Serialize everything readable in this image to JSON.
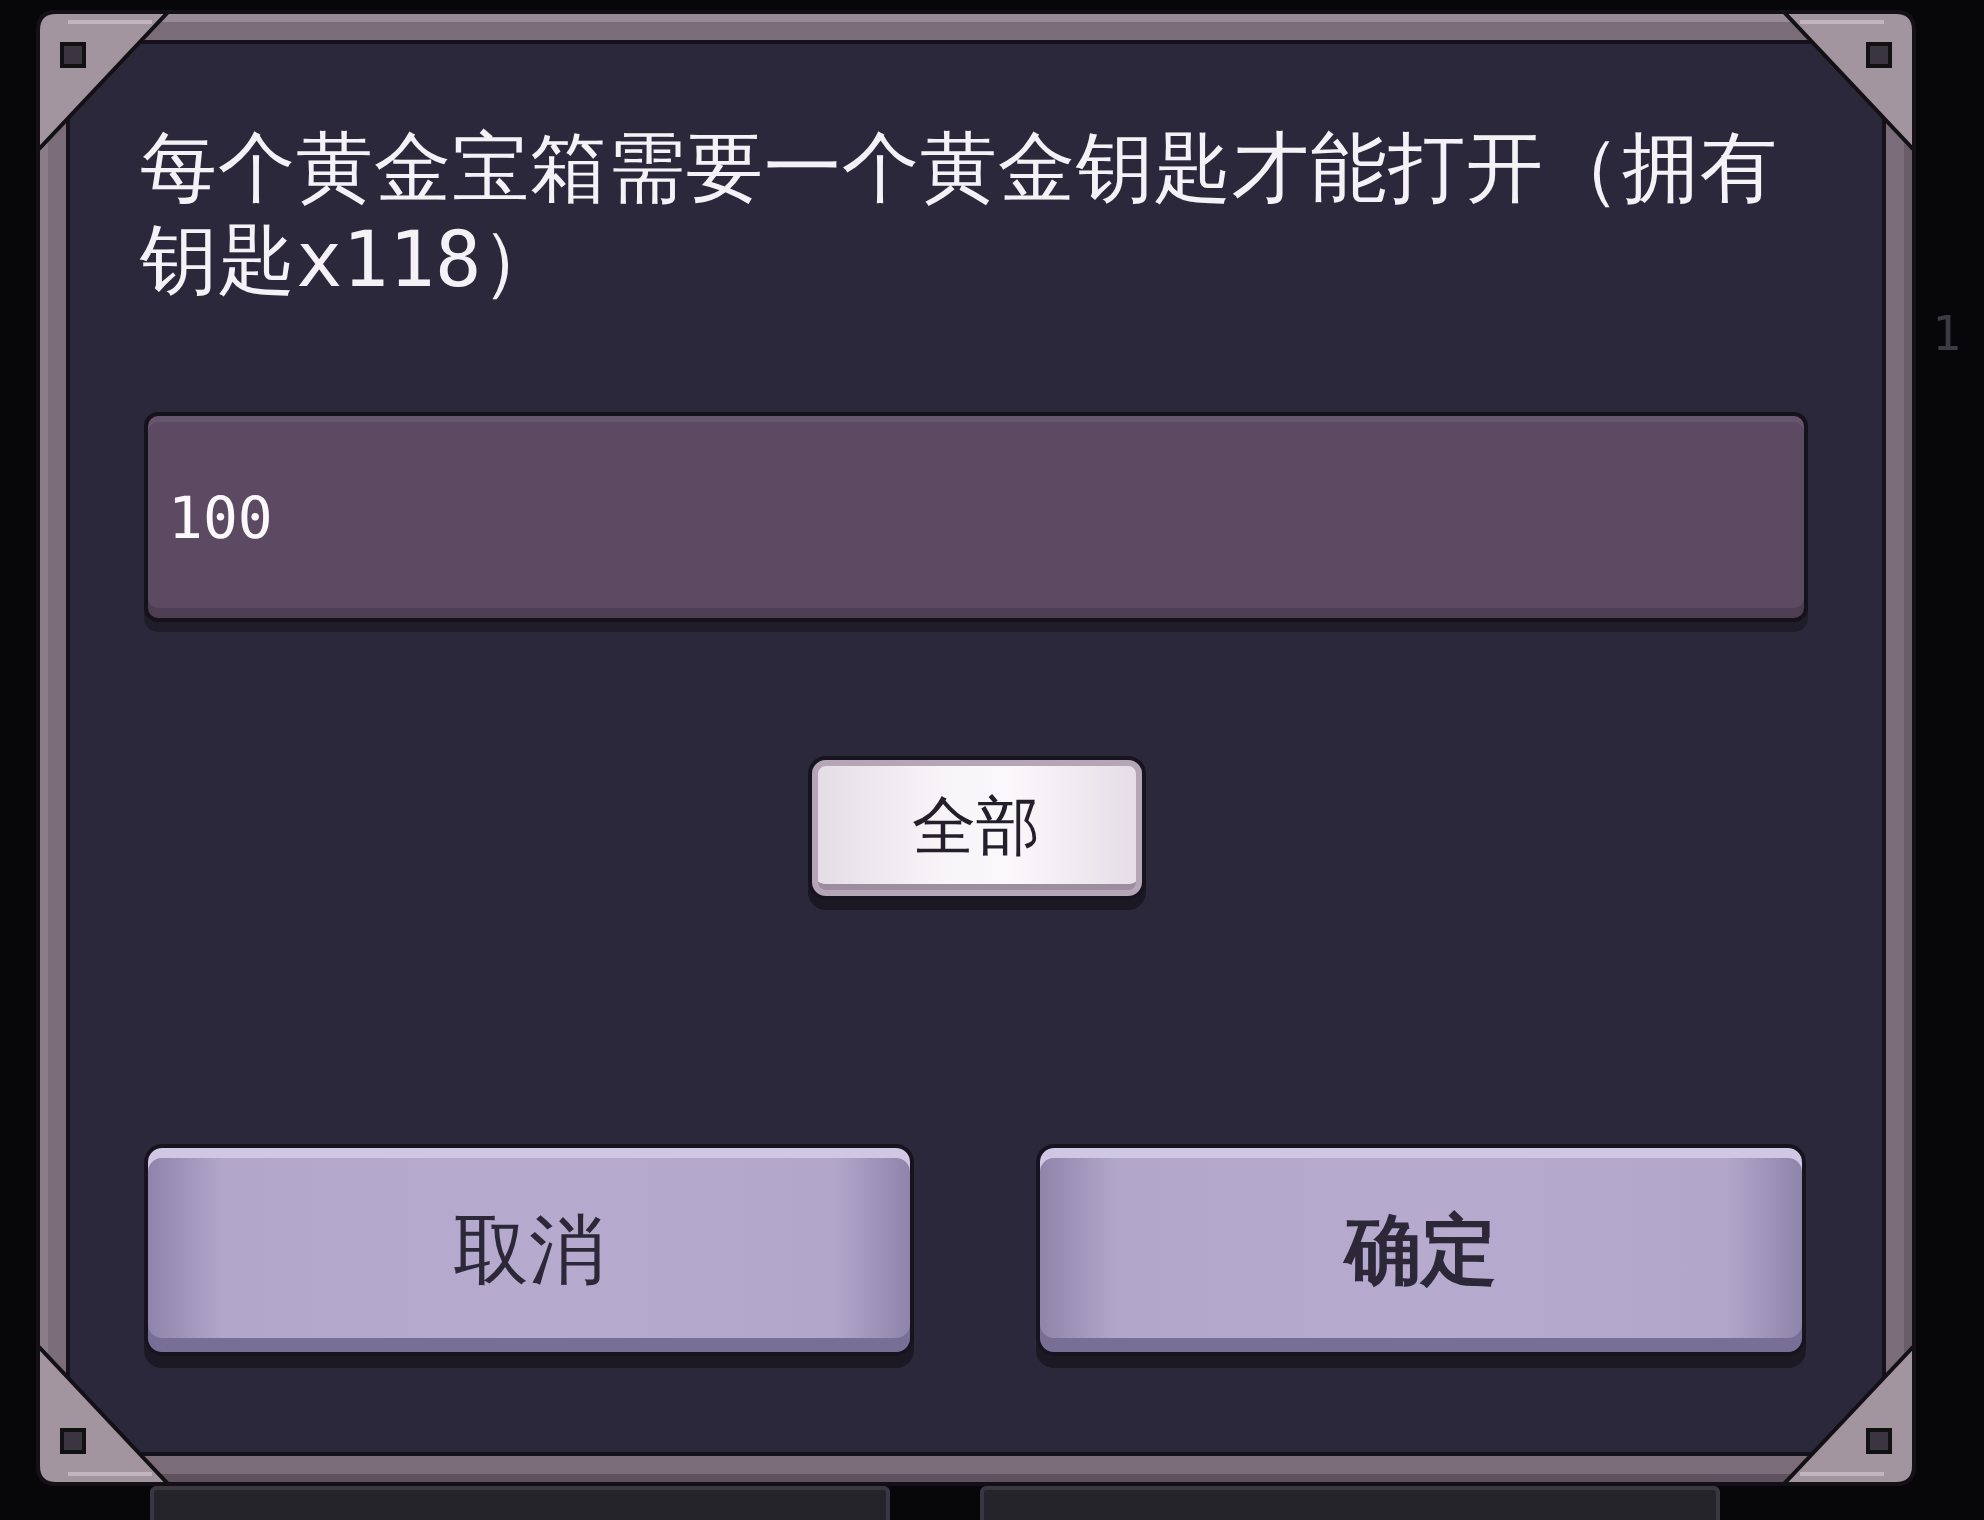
{
  "message": "每个黄金宝箱需要一个黄金钥匙才能打开（拥有钥匙x118）",
  "amount_field": {
    "value": "100"
  },
  "all_button": {
    "label": "全部"
  },
  "buttons": [
    {
      "label": "取消",
      "kind": "cancel"
    },
    {
      "label": "确定",
      "kind": "confirm"
    }
  ],
  "background": {
    "edge_text": "1"
  }
}
